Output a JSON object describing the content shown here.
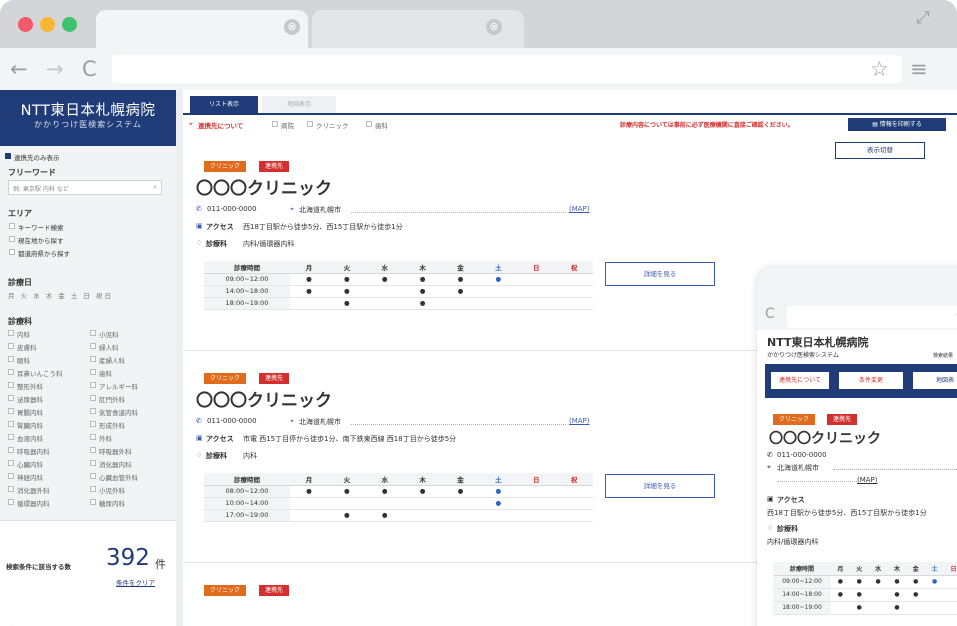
{
  "colors": {
    "navy": "#1f3c78",
    "orange": "#e06b1c",
    "red": "#d32f2f",
    "link_blue": "#3a5bb5",
    "weekday_blue": "#2b66c4"
  },
  "browser": {
    "nav_back": "←",
    "nav_forward": "→",
    "reload": "C",
    "star": "☆",
    "menu": "≡",
    "tab_close": "⊗",
    "expand": "⤢"
  },
  "sidebar": {
    "hospital_name": "NTT東日本札幌病院",
    "system_name": "かかりつけ医検索システム",
    "affiliated_only": "連携先のみ表示",
    "freeword_label": "フリーワード",
    "freeword_placeholder": "例: 東京駅 内科 など",
    "area_label": "エリア",
    "area_options": [
      "キーワード検索",
      "現在地から探す",
      "都道府県から探す"
    ],
    "days_label": "診療日",
    "days": "月 火 水 木 金 土 日 祝日",
    "departments_label": "診療科",
    "departments": [
      [
        "内科",
        "小児科"
      ],
      [
        "皮膚科",
        "婦人科"
      ],
      [
        "眼科",
        "産婦人科"
      ],
      [
        "耳鼻いんこう科",
        "歯科"
      ],
      [
        "整形外科",
        "アレルギー科"
      ],
      [
        "泌尿器科",
        "肛門外科"
      ],
      [
        "胃腸内科",
        "気管食道内科"
      ],
      [
        "腎臓内科",
        "形成外科"
      ],
      [
        "血液内科",
        "外科"
      ],
      [
        "呼吸器内科",
        "呼吸器外科"
      ],
      [
        "心臓内科",
        "消化器内科"
      ],
      [
        "神経内科",
        "心臓血管外科"
      ],
      [
        "消化器外科",
        "小児外科"
      ],
      [
        "循環器内科",
        "糖尿内科"
      ]
    ],
    "count_label": "検索条件に該当する数",
    "count_value": "392",
    "count_unit": "件",
    "clear_link": "条件をクリア"
  },
  "main": {
    "view_tabs": [
      {
        "label": "リスト表示"
      },
      {
        "label": "地図表示"
      }
    ],
    "filter": {
      "about": "連携先について",
      "options": [
        "病院",
        "クリニック",
        "歯科"
      ]
    },
    "notice": "診療内容については事前に必ず医療機関に直接ご確認ください。",
    "print_button": "情報を印刷する",
    "display_toggle": "表示切替",
    "badge_clinic": "クリニック",
    "badge_partner": "連携先",
    "schedule_header": [
      "診療時間",
      "月",
      "火",
      "水",
      "木",
      "金",
      "土",
      "日",
      "祝"
    ],
    "access_label": "アクセス",
    "department_label": "診療科",
    "detail_button": "詳細を見る",
    "clinics": [
      {
        "name": "〇〇〇クリニック",
        "phone": "011-000-0000",
        "address": "北海道札幌市",
        "map": "(MAP)",
        "access": "西18丁目駅から徒歩5分、西15丁目駅から徒歩1分",
        "departments": "内科/循環器内科",
        "schedule": [
          {
            "time": "09:00~12:00",
            "days": [
              "●",
              "●",
              "●",
              "●",
              "●",
              "●",
              "",
              ""
            ]
          },
          {
            "time": "14:00~18:00",
            "days": [
              "●",
              "●",
              "",
              "●",
              "●",
              "",
              "",
              ""
            ]
          },
          {
            "time": "18:00~19:00",
            "days": [
              "",
              "●",
              "",
              "●",
              "",
              "",
              "",
              ""
            ]
          }
        ]
      },
      {
        "name": "〇〇〇クリニック",
        "phone": "011-000-0000",
        "address": "北海道札幌市",
        "map": "(MAP)",
        "access": "市電 西15丁目停から徒歩1分、南下鉄東西線 西18丁目から徒歩5分",
        "departments": "内科",
        "schedule": [
          {
            "time": "08:00~12:00",
            "days": [
              "●",
              "●",
              "●",
              "●",
              "●",
              "●",
              "",
              ""
            ]
          },
          {
            "time": "10:00~14:00",
            "days": [
              "",
              "",
              "",
              "",
              "",
              "●",
              "",
              ""
            ]
          },
          {
            "time": "17:00~19:00",
            "days": [
              "",
              "●",
              "●",
              "",
              "",
              "",
              "",
              ""
            ]
          }
        ]
      }
    ]
  },
  "mobile": {
    "reload": "C",
    "star": "☆",
    "hospital_name": "NTT東日本札幌病院",
    "system_name": "かかりつけ医検索システム",
    "result_label": "検索結果",
    "tabs": [
      "連携先について",
      "条件変更",
      "地図表"
    ],
    "badge_clinic": "クリニック",
    "badge_partner": "連携先",
    "clinic_name": "〇〇〇クリニック",
    "phone": "011-000-0000",
    "address": "北海道札幌市",
    "map": "(MAP)",
    "access_label": "アクセス",
    "access": "西18丁目駅から徒歩5分、西15丁目駅から徒歩1分",
    "department_label": "診療科",
    "departments": "内科/循環器内科",
    "schedule_header": [
      "診療時間",
      "月",
      "火",
      "水",
      "木",
      "金",
      "土",
      "日"
    ],
    "schedule": [
      {
        "time": "09:00~12:00",
        "days": [
          "●",
          "●",
          "●",
          "●",
          "●",
          "●",
          ""
        ]
      },
      {
        "time": "14:00~18:00",
        "days": [
          "●",
          "●",
          "",
          "●",
          "●",
          "",
          ""
        ]
      },
      {
        "time": "18:00~19:00",
        "days": [
          "",
          "●",
          "",
          "●",
          "",
          "",
          ""
        ]
      }
    ]
  }
}
